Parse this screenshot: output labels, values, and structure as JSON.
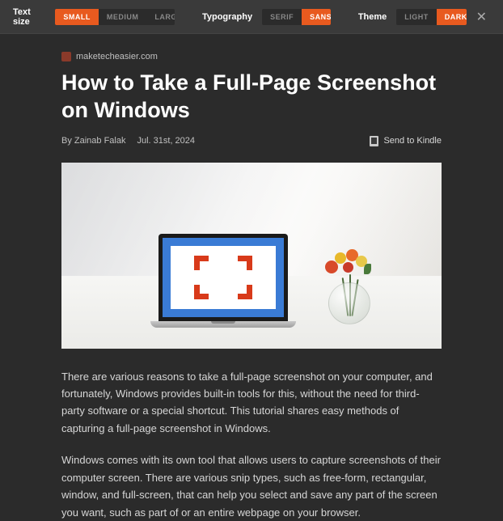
{
  "toolbar": {
    "text_size_label": "Text size",
    "text_size_options": [
      "SMALL",
      "MEDIUM",
      "LARGE"
    ],
    "text_size_active": 0,
    "typography_label": "Typography",
    "typography_options": [
      "SERIF",
      "SANS"
    ],
    "typography_active": 1,
    "theme_label": "Theme",
    "theme_options": [
      "LIGHT",
      "DARK"
    ],
    "theme_active": 1
  },
  "article": {
    "site": "maketecheasier.com",
    "title": "How to Take a Full-Page Screenshot on Windows",
    "byline": "By Zainab Falak",
    "date": "Jul. 31st, 2024",
    "send_kindle": "Send to Kindle",
    "paragraphs": [
      "There are various reasons to take a full-page screenshot on your computer, and fortunately, Windows provides built-in tools for this, without the need for third-party software or a special shortcut. This tutorial shares easy methods of capturing a full-page screenshot in Windows.",
      "Windows comes with its own tool that allows users to capture screenshots of their computer screen. There are various snip types, such as free-form, rectangular, window, and full-screen, that can help you select and save any part of the screen you want, such as part of or an entire webpage on your browser."
    ]
  }
}
